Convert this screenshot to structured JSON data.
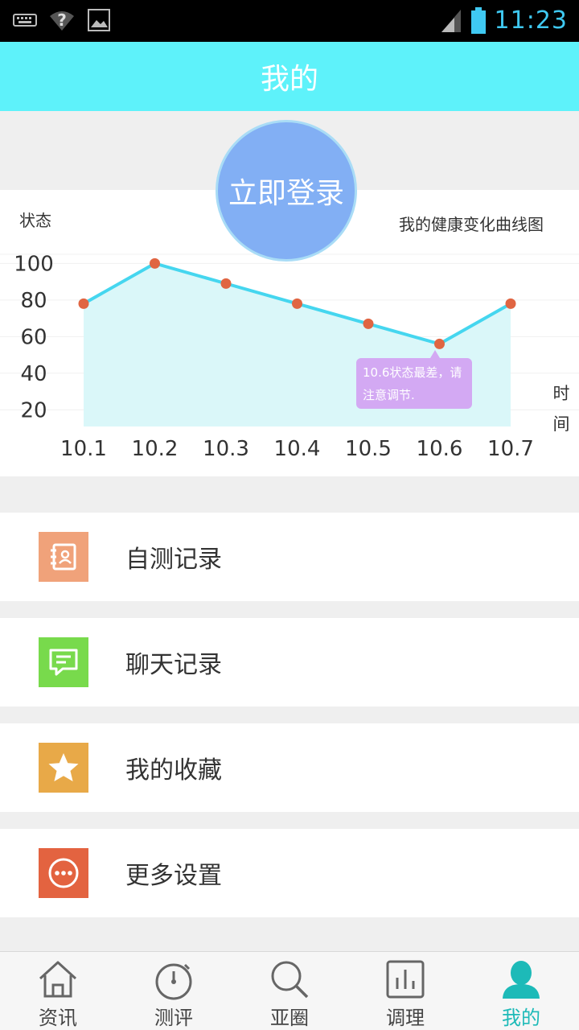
{
  "status_bar": {
    "time": "11:23"
  },
  "header": {
    "title": "我的"
  },
  "login": {
    "label": "立即登录"
  },
  "chart_data": {
    "type": "area",
    "title": "我的健康变化曲线图",
    "ylabel": "状态",
    "xlabel": "时间",
    "categories": [
      "10.1",
      "10.2",
      "10.3",
      "10.4",
      "10.5",
      "10.6",
      "10.7"
    ],
    "values": [
      78,
      100,
      89,
      78,
      67,
      56,
      78
    ],
    "yticks": [
      20,
      40,
      60,
      80,
      100
    ],
    "ylim": [
      10,
      105
    ],
    "grid": true,
    "colors": {
      "line": "#45d6ef",
      "fill": "#daf7f9",
      "point": "#e06542"
    },
    "annotation": {
      "text": "10.6状态最差，请注意调节.",
      "category": "10.6"
    }
  },
  "menu": [
    {
      "label": "自测记录",
      "icon": "contact-book-icon",
      "color": "#f0a27a"
    },
    {
      "label": "聊天记录",
      "icon": "chat-bubble-icon",
      "color": "#78da4c"
    },
    {
      "label": "我的收藏",
      "icon": "star-icon",
      "color": "#e8a948"
    },
    {
      "label": "更多设置",
      "icon": "more-dots-icon",
      "color": "#e36340"
    }
  ],
  "tabs": [
    {
      "label": "资讯",
      "icon": "home-icon"
    },
    {
      "label": "测评",
      "icon": "stopwatch-icon"
    },
    {
      "label": "亚圈",
      "icon": "magnifier-icon"
    },
    {
      "label": "调理",
      "icon": "bar-chart-icon"
    },
    {
      "label": "我的",
      "icon": "person-icon",
      "active": true
    }
  ],
  "colors": {
    "accent": "#5ef2fa",
    "tab_active": "#1dbab8",
    "login": "#82aff4"
  }
}
